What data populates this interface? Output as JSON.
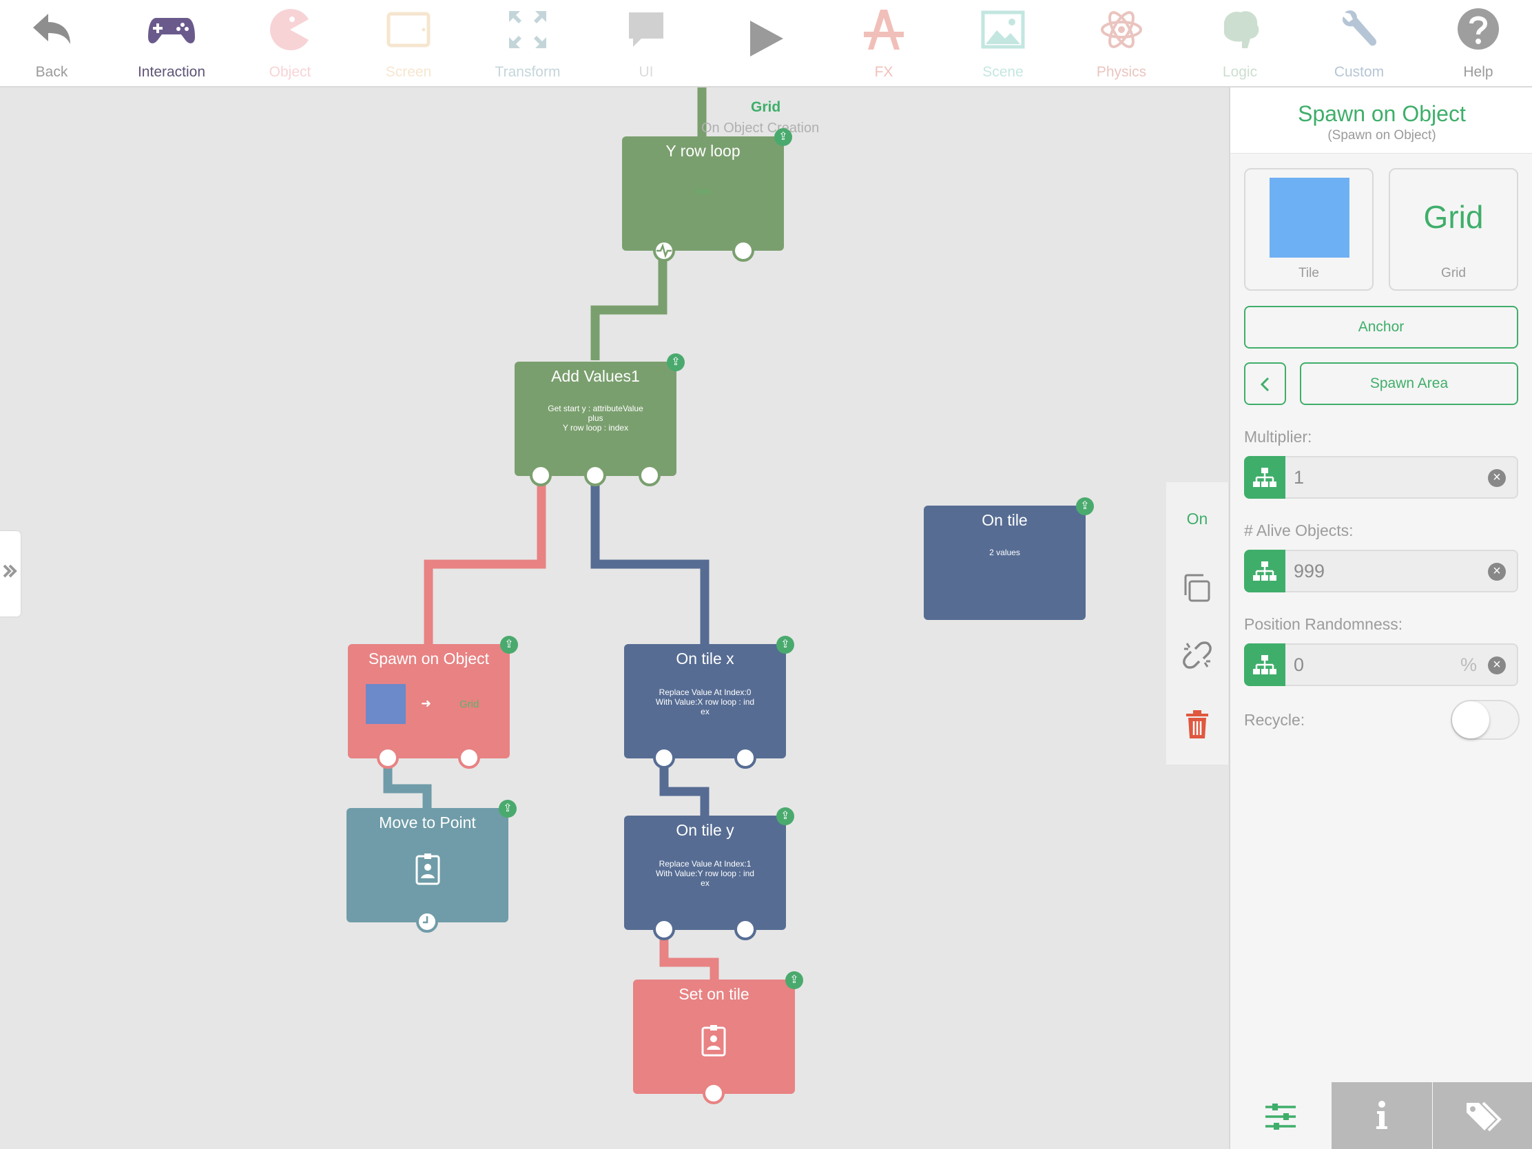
{
  "toolbar": {
    "items": [
      {
        "label": "Back",
        "icon": "back-arrow-icon"
      },
      {
        "label": "Interaction",
        "icon": "gamepad-icon"
      },
      {
        "label": "Object",
        "icon": "pacman-icon"
      },
      {
        "label": "Screen",
        "icon": "tablet-icon"
      },
      {
        "label": "Transform",
        "icon": "expand-arrows-icon"
      },
      {
        "label": "UI",
        "icon": "speech-bubble-icon"
      },
      {
        "label": "",
        "icon": "play-icon"
      },
      {
        "label": "FX",
        "icon": "paint-tools-icon"
      },
      {
        "label": "Scene",
        "icon": "image-icon"
      },
      {
        "label": "Physics",
        "icon": "atom-icon"
      },
      {
        "label": "Logic",
        "icon": "brain-icon"
      },
      {
        "label": "Custom",
        "icon": "wrench-icon"
      },
      {
        "label": "Help",
        "icon": "question-icon"
      }
    ]
  },
  "canvas": {
    "top_label": "Grid",
    "top_sublabel": "On Object Creation",
    "nodes": {
      "y_row_loop": {
        "title": "Y row loop",
        "body": "Grid"
      },
      "add_values": {
        "title": "Add Values1",
        "body_lines": [
          "Get start y : attributeValue",
          "plus",
          "Y row loop : index"
        ]
      },
      "on_tile": {
        "title": "On tile",
        "body": "2 values"
      },
      "spawn_on_object": {
        "title": "Spawn on Object",
        "target": "Grid"
      },
      "on_tile_x": {
        "title": "On tile x",
        "body_lines": [
          "Replace Value At Index:0",
          "With Value:X row loop : ind",
          "ex"
        ]
      },
      "move_to_point": {
        "title": "Move to Point"
      },
      "on_tile_y": {
        "title": "On tile y",
        "body_lines": [
          "Replace Value At Index:1",
          "With Value:Y row loop : ind",
          "ex"
        ]
      },
      "set_on_tile": {
        "title": "Set on tile"
      }
    }
  },
  "action_strip": {
    "on_label": "On"
  },
  "panel": {
    "title": "Spawn on Object",
    "subtitle": "(Spawn on Object)",
    "tile_card_label": "Tile",
    "grid_card_value": "Grid",
    "grid_card_label": "Grid",
    "anchor_label": "Anchor",
    "spawn_area_label": "Spawn Area",
    "multiplier": {
      "label": "Multiplier:",
      "value": "1"
    },
    "alive_objects": {
      "label": "# Alive Objects:",
      "value": "999"
    },
    "position_randomness": {
      "label": "Position Randomness:",
      "value": "0",
      "unit": "%"
    },
    "recycle": {
      "label": "Recycle:",
      "on": false
    }
  },
  "colors": {
    "accent_green": "#3fae6a",
    "node_green": "#7a9f6e",
    "node_red": "#e88283",
    "node_blue": "#566c93",
    "node_teal": "#6f9ca8",
    "tile_blue": "#6eb0f4"
  }
}
